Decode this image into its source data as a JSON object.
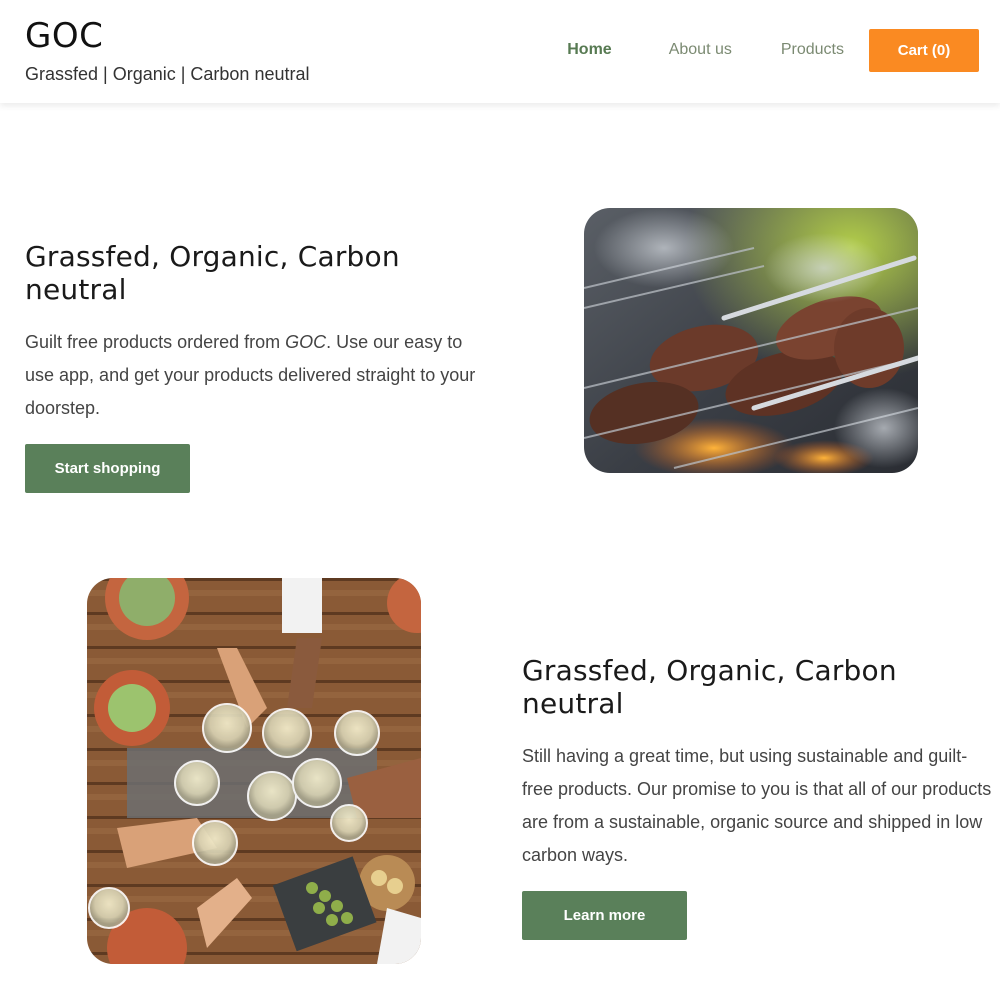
{
  "header": {
    "brand": "GOC",
    "tagline": "Grassfed | Organic | Carbon neutral"
  },
  "nav": {
    "home": "Home",
    "about": "About us",
    "products": "Products",
    "cart": "Cart (0)"
  },
  "section1": {
    "heading": "Grassfed, Organic, Carbon neutral",
    "body_before": "Guilt free products ordered from ",
    "body_brand": "GOC",
    "body_after": ". Use our easy to use app, and get your products delivered straight to your doorstep.",
    "button": "Start shopping"
  },
  "section2": {
    "heading": "Grassfed, Organic, Carbon neutral",
    "body": "Still having a great time, but using sustainable and guilt-free products. Our promise to you is that all of our products are from a sustainable, organic source and shipped in low carbon ways.",
    "button": "Learn more"
  },
  "colors": {
    "accent_orange": "#fa8a22",
    "button_green": "#5a805a",
    "nav_active": "#577a52"
  }
}
